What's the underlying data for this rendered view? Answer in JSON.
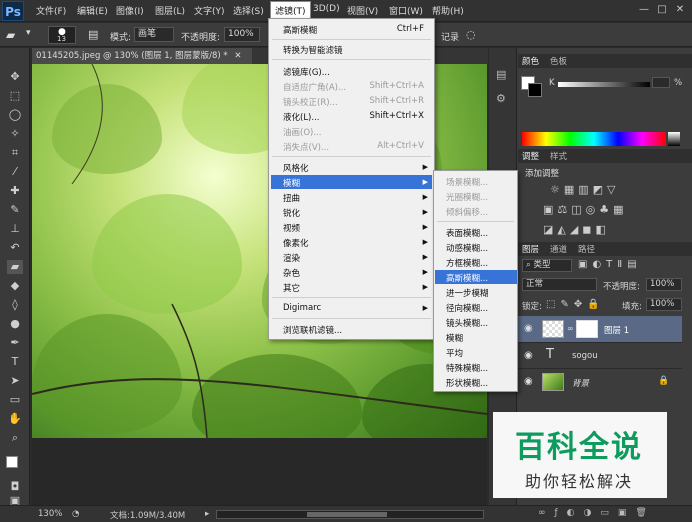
{
  "menubar": {
    "logo": "Ps",
    "items": [
      "文件(F)",
      "编辑(E)",
      "图像(I)",
      "图层(L)",
      "文字(Y)",
      "选择(S)",
      "滤镜(T)",
      "3D(D)",
      "视图(V)",
      "窗口(W)",
      "帮助(H)"
    ],
    "window_buttons": [
      "—",
      "□",
      "✕"
    ]
  },
  "options": {
    "brush_size": "13",
    "mode_label": "模式:",
    "mode_value": "画笔",
    "opacity_label": "不透明度:",
    "opacity_value": "100%",
    "history_text": "记录"
  },
  "document": {
    "tab_title": "01145205.jpeg @ 130% (图层 1, 图层蒙版/8) *",
    "close": "✕"
  },
  "status": {
    "zoom": "130%",
    "doc_info": "文档:1.09M/3.40M"
  },
  "filter_menu": {
    "items": [
      {
        "label": "高斯模糊",
        "shortcut": "Ctrl+F",
        "disabled": false
      },
      {
        "label": "转换为智能滤镜",
        "shortcut": "",
        "disabled": false
      },
      {
        "label": "滤镜库(G)...",
        "shortcut": "",
        "disabled": false
      },
      {
        "label": "自适应广角(A)...",
        "shortcut": "Shift+Ctrl+A",
        "disabled": true
      },
      {
        "label": "镜头校正(R)...",
        "shortcut": "Shift+Ctrl+R",
        "disabled": true
      },
      {
        "label": "液化(L)...",
        "shortcut": "Shift+Ctrl+X",
        "disabled": false
      },
      {
        "label": "油画(O)...",
        "shortcut": "",
        "disabled": true
      },
      {
        "label": "消失点(V)...",
        "shortcut": "Alt+Ctrl+V",
        "disabled": true
      },
      {
        "label": "风格化",
        "shortcut": "",
        "disabled": false
      },
      {
        "label": "模糊",
        "shortcut": "",
        "disabled": false
      },
      {
        "label": "扭曲",
        "shortcut": "",
        "disabled": false
      },
      {
        "label": "锐化",
        "shortcut": "",
        "disabled": false
      },
      {
        "label": "视频",
        "shortcut": "",
        "disabled": false
      },
      {
        "label": "像素化",
        "shortcut": "",
        "disabled": false
      },
      {
        "label": "渲染",
        "shortcut": "",
        "disabled": false
      },
      {
        "label": "杂色",
        "shortcut": "",
        "disabled": false
      },
      {
        "label": "其它",
        "shortcut": "",
        "disabled": false
      },
      {
        "label": "Digimarc",
        "shortcut": "",
        "disabled": false
      },
      {
        "label": "浏览联机滤镜...",
        "shortcut": "",
        "disabled": false
      }
    ]
  },
  "blur_menu": {
    "items": [
      {
        "label": "场景模糊...",
        "disabled": true
      },
      {
        "label": "光圈模糊...",
        "disabled": true
      },
      {
        "label": "倾斜偏移...",
        "disabled": true
      },
      {
        "label": "表面模糊...",
        "disabled": false
      },
      {
        "label": "动感模糊...",
        "disabled": false
      },
      {
        "label": "方框模糊...",
        "disabled": false
      },
      {
        "label": "高斯模糊...",
        "disabled": false
      },
      {
        "label": "进一步模糊",
        "disabled": false
      },
      {
        "label": "径向模糊...",
        "disabled": false
      },
      {
        "label": "镜头模糊...",
        "disabled": false
      },
      {
        "label": "模糊",
        "disabled": false
      },
      {
        "label": "平均",
        "disabled": false
      },
      {
        "label": "特殊模糊...",
        "disabled": false
      },
      {
        "label": "形状模糊...",
        "disabled": false
      }
    ]
  },
  "color_panel": {
    "tabs": [
      "颜色",
      "色板"
    ],
    "k_label": "K",
    "percent": "%"
  },
  "adjust_panel": {
    "tabs": [
      "调整",
      "样式"
    ],
    "title": "添加调整"
  },
  "layers_panel": {
    "tabs": [
      "图层",
      "通道",
      "路径"
    ],
    "filter_label": "类型",
    "blend_mode": "正常",
    "opacity_label": "不透明度:",
    "opacity_value": "100%",
    "lock_label": "锁定:",
    "fill_label": "填充:",
    "fill_value": "100%",
    "layers": [
      {
        "name": "图层 1"
      },
      {
        "name": "sogou"
      },
      {
        "name": "背景"
      }
    ]
  },
  "watermark": {
    "title": "百科全说",
    "subtitle": "助你轻松解决"
  }
}
